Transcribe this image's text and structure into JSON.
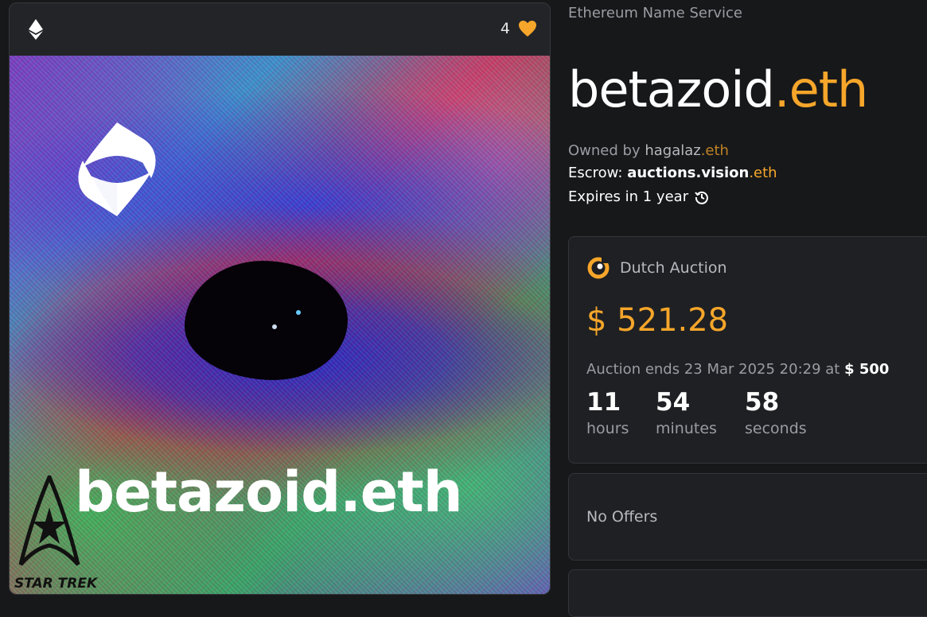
{
  "card": {
    "likes": "4",
    "art_name": "betazoid.eth",
    "startrek_text": "STAR TREK"
  },
  "details": {
    "subtitle": "Ethereum Name Service",
    "title_name": "betazoid",
    "title_tld": ".eth",
    "owned_label": "Owned by ",
    "owner_name": "hagalaz",
    "owner_tld": ".eth",
    "escrow_label": "Escrow: ",
    "escrow_name": "auctions.vision",
    "escrow_tld": ".eth",
    "expires": "Expires in 1 year"
  },
  "auction": {
    "label": "Dutch Auction",
    "price": "$ 521.28",
    "ends_text": "Auction ends 23 Mar 2025 20:29 at ",
    "ends_price": "$ 500",
    "countdown": [
      {
        "value": "11",
        "unit": "hours"
      },
      {
        "value": "54",
        "unit": "minutes"
      },
      {
        "value": "58",
        "unit": "seconds"
      }
    ]
  },
  "offers": {
    "text": "No Offers"
  },
  "colors": {
    "accent": "#f6a62a",
    "background": "#17181a",
    "panel": "#1f2023"
  }
}
